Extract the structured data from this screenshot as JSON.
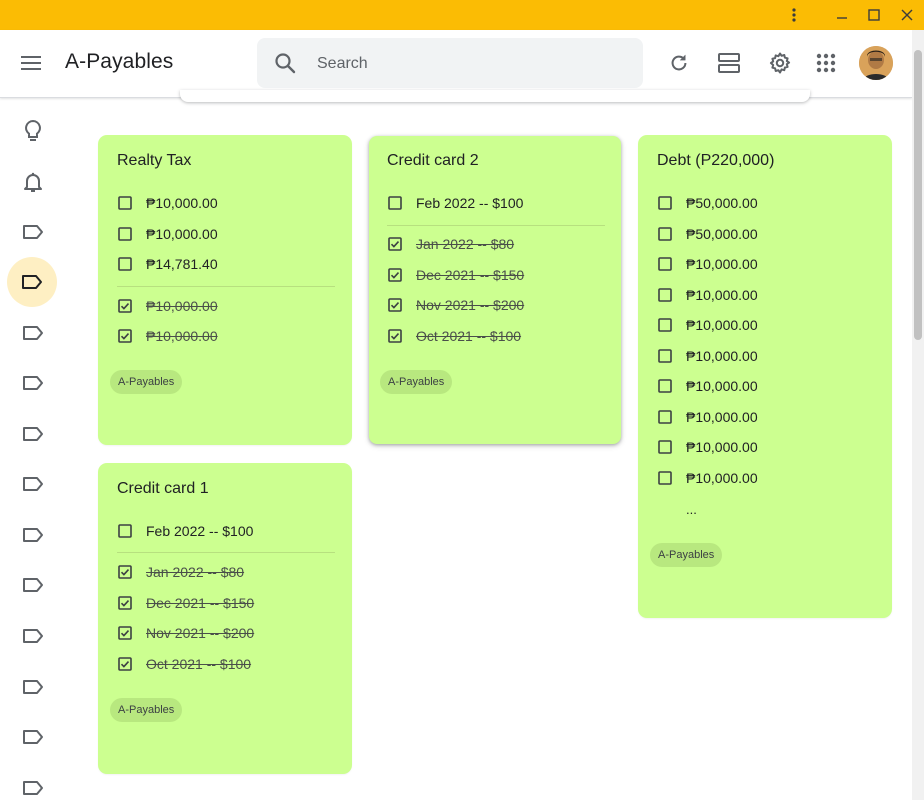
{
  "window": {
    "menu_icon": "more-vert-icon",
    "minimize_icon": "minimize-icon",
    "maximize_icon": "maximize-icon",
    "close_icon": "close-icon"
  },
  "header": {
    "title": "A-Payables",
    "search": {
      "placeholder": "Search",
      "value": ""
    }
  },
  "colors": {
    "titlebar": "#fbbc04",
    "note": "#ccff90",
    "active_sidebar": "#feefc3"
  },
  "sidebar": {
    "items": [
      {
        "icon": "lightbulb-icon"
      },
      {
        "icon": "bell-icon"
      },
      {
        "icon": "label-icon"
      },
      {
        "icon": "label-icon",
        "active": true
      },
      {
        "icon": "label-icon"
      },
      {
        "icon": "label-icon"
      },
      {
        "icon": "label-icon"
      },
      {
        "icon": "label-icon"
      },
      {
        "icon": "label-icon"
      },
      {
        "icon": "label-icon"
      },
      {
        "icon": "label-icon"
      },
      {
        "icon": "label-icon"
      },
      {
        "icon": "label-icon"
      },
      {
        "icon": "label-icon"
      }
    ]
  },
  "notes": {
    "realty": {
      "title": "Realty Tax",
      "open": [
        "₱10,000.00",
        "₱10,000.00",
        "₱14,781.40"
      ],
      "done": [
        "₱10,000.00",
        "₱10,000.00"
      ],
      "label": "A-Payables"
    },
    "cc2": {
      "title": "Credit card 2",
      "open": [
        "Feb 2022 -- $100"
      ],
      "done": [
        "Jan 2022 -- $80",
        "Dec 2021 -- $150",
        "Nov 2021 -- $200",
        "Oct 2021 -- $100"
      ],
      "label": "A-Payables"
    },
    "debt": {
      "title": "Debt (P220,000)",
      "open": [
        "₱50,000.00",
        "₱50,000.00",
        "₱10,000.00",
        "₱10,000.00",
        "₱10,000.00",
        "₱10,000.00",
        "₱10,000.00",
        "₱10,000.00",
        "₱10,000.00",
        "₱10,000.00"
      ],
      "more": "...",
      "label": "A-Payables"
    },
    "cc1": {
      "title": "Credit card 1",
      "open": [
        "Feb 2022 -- $100"
      ],
      "done": [
        "Jan 2022 -- $80",
        "Dec 2021 -- $150",
        "Nov 2021 -- $200",
        "Oct 2021 -- $100"
      ],
      "label": "A-Payables"
    }
  }
}
